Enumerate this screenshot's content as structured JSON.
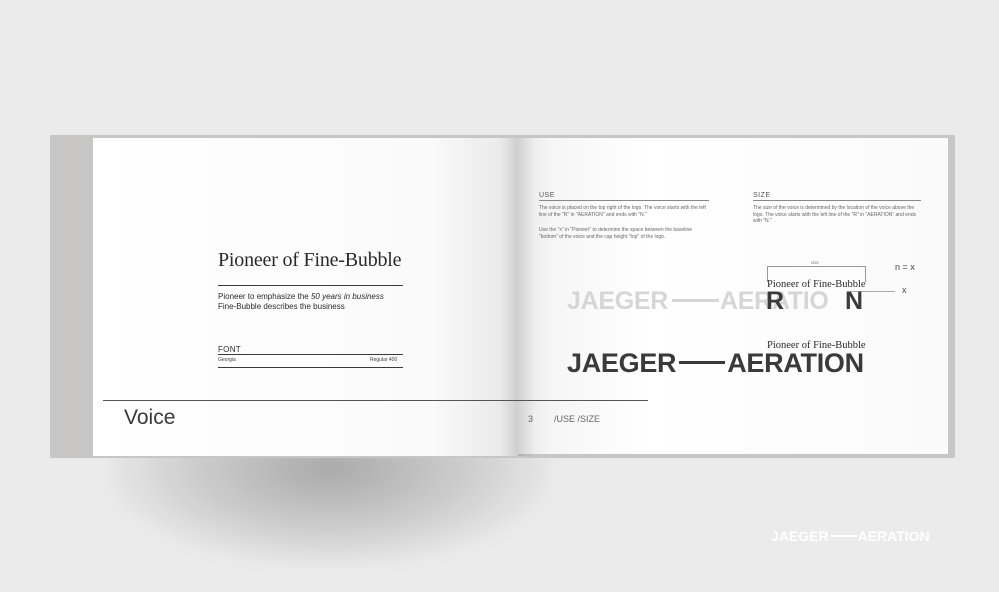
{
  "left_page": {
    "title": "Pioneer of Fine-Bubble",
    "desc_line1_pre": "Pioneer to emphasize the ",
    "desc_line1_em": "50 years in business",
    "desc_line2": "Fine-Bubble describes the business",
    "font_label": "FONT",
    "font_name": "Georgia",
    "font_weight": "Regular 400",
    "section_title": "Voice"
  },
  "right_page": {
    "use_heading": "USE",
    "use_text_1": "The voice is placed on the top right of the logo. The voice starts with the left line of the \"R\" in \"AERATION\" and ends with \"N.\"",
    "use_text_2": "Use the \"x\" in \"Pioneer\" to determine the space between the baseline \"bottom\" of the voice and the cap height \"top\" of the logo.",
    "size_heading": "SIZE",
    "size_text": "The size of the voice is determined by the location of the voice above the logo. The voice starts with the left line of the \"R\" in \"AERATION\" and ends with \"N.\"",
    "size_label": "size",
    "n_eq_x": "n = x",
    "x_label": "x",
    "voice_small_1": "Pioneer of Fine-Bubble",
    "voice_small_2": "Pioneer of Fine-Bubble",
    "logo_left": "JAEGER",
    "logo_right_light": "AERATIO",
    "logo_right_r": "R",
    "logo_right_n": "N",
    "logo_right_dark": "AERATION",
    "page_number": "3",
    "section_path": "/USE /SIZE"
  },
  "brand": {
    "left": "JAEGER",
    "right": "AERATION"
  },
  "colors": {
    "background": "#ebebeb",
    "ink": "#3a3a3a",
    "logo_ghost": "#d6d6d6",
    "brand_mark": "#ffffff"
  }
}
